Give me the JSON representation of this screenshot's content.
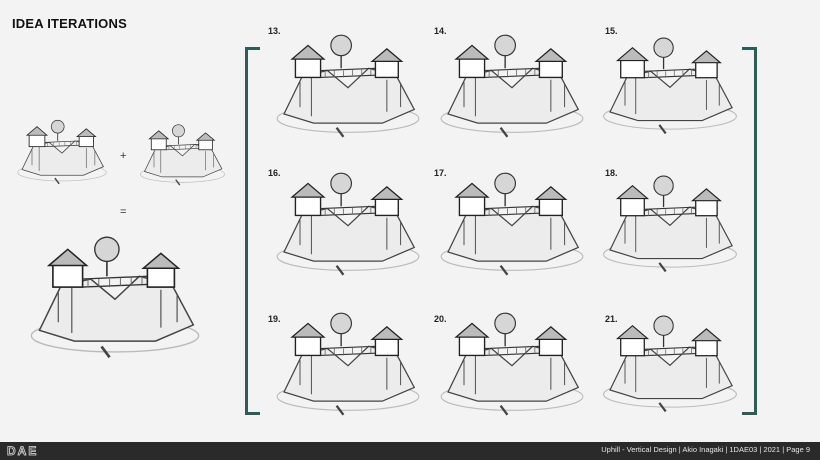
{
  "page_title": "IDEA ITERATIONS",
  "operators": {
    "plus": "+",
    "equals": "="
  },
  "iterations": [
    "13.",
    "14.",
    "15.",
    "16.",
    "17.",
    "18.",
    "19.",
    "20.",
    "21."
  ],
  "footer": {
    "text": "Uphill - Vertical Design | Akio Inagaki | 1DAE03 | 2021 | Page 9",
    "logo_text": "DAE"
  },
  "colors": {
    "bracket": "#2f5c56",
    "footer_bg": "#2a2a2a",
    "background": "#f3f3f3"
  }
}
